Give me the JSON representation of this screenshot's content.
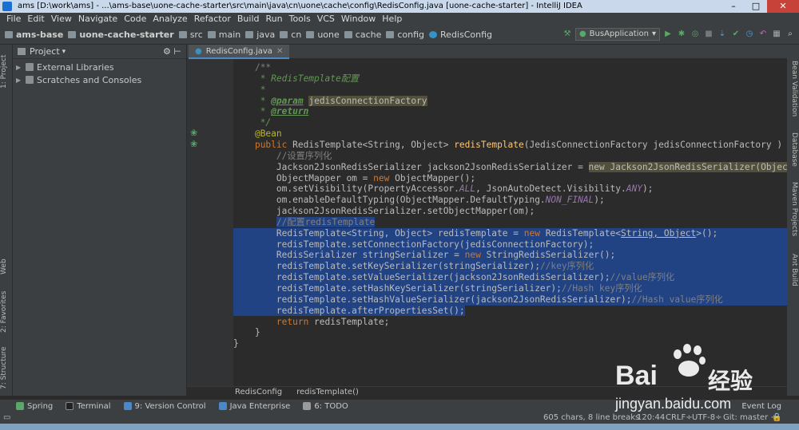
{
  "window": {
    "title": "ams [D:\\work\\ams] - ...\\ams-base\\uone-cache-starter\\src\\main\\java\\cn\\uone\\cache\\config\\RedisConfig.java [uone-cache-starter] - IntelliJ IDEA"
  },
  "menu": [
    "File",
    "Edit",
    "View",
    "Navigate",
    "Code",
    "Analyze",
    "Refactor",
    "Build",
    "Run",
    "Tools",
    "VCS",
    "Window",
    "Help"
  ],
  "breadcrumbs": [
    "ams-base",
    "uone-cache-starter",
    "src",
    "main",
    "java",
    "cn",
    "uone",
    "cache",
    "config",
    "RedisConfig"
  ],
  "run_config": "BusApplication",
  "project_panel": {
    "title": "Project",
    "items": [
      "External Libraries",
      "Scratches and Consoles"
    ]
  },
  "left_tabs": {
    "project": "1: Project",
    "web": "Web",
    "favorites": "2: Favorites",
    "structure": "7: Structure"
  },
  "right_tabs": [
    "Bean Validation",
    "Database",
    "Maven Projects",
    "Ant Build"
  ],
  "editor": {
    "tab": "RedisConfig.java"
  },
  "code_lines": [
    {
      "i": "    ",
      "segs": [
        [
          "cm",
          "/**"
        ]
      ]
    },
    {
      "i": "     ",
      "segs": [
        [
          "jd",
          "* RedisTemplate配置"
        ]
      ]
    },
    {
      "i": "     ",
      "segs": [
        [
          "jd",
          "*"
        ]
      ]
    },
    {
      "i": "     ",
      "segs": [
        [
          "jd",
          "* "
        ],
        [
          "jt",
          "@param"
        ],
        [
          "jd",
          " "
        ],
        [
          "hl",
          "jedisConnectionFactory"
        ]
      ]
    },
    {
      "i": "     ",
      "segs": [
        [
          "jd",
          "* "
        ],
        [
          "jt",
          "@return"
        ]
      ]
    },
    {
      "i": "     ",
      "segs": [
        [
          "jd",
          "*/"
        ]
      ]
    },
    {
      "i": "    ",
      "segs": [
        [
          "ann",
          "@Bean"
        ]
      ]
    },
    {
      "i": "    ",
      "segs": [
        [
          "kw",
          "public "
        ],
        [
          "",
          "RedisTemplate<String, Object> "
        ],
        [
          "fn",
          "redisTemplate"
        ],
        [
          "",
          "(JedisConnectionFactory jedisConnectionFactory ) {"
        ]
      ]
    },
    {
      "i": "        ",
      "segs": [
        [
          "cm",
          "//设置序列化"
        ]
      ]
    },
    {
      "i": "        ",
      "segs": [
        [
          "",
          "Jackson2JsonRedisSerializer jackson2JsonRedisSerializer = "
        ],
        [
          "hl",
          "new Jackson2JsonRedisSerializer(Object."
        ]
      ]
    },
    {
      "i": "        ",
      "segs": [
        [
          "",
          "ObjectMapper om = "
        ],
        [
          "kw",
          "new "
        ],
        [
          "",
          "ObjectMapper();"
        ]
      ]
    },
    {
      "i": "        ",
      "segs": [
        [
          "",
          "om.setVisibility(PropertyAccessor."
        ],
        [
          "st",
          "ALL"
        ],
        [
          "",
          ", JsonAutoDetect.Visibility."
        ],
        [
          "st",
          "ANY"
        ],
        [
          "",
          ");"
        ]
      ]
    },
    {
      "i": "        ",
      "segs": [
        [
          "",
          "om.enableDefaultTyping(ObjectMapper.DefaultTyping."
        ],
        [
          "st",
          "NON_FINAL"
        ],
        [
          "",
          ");"
        ]
      ]
    },
    {
      "i": "        ",
      "segs": [
        [
          "",
          "jackson2JsonRedisSerializer.setObjectMapper(om);"
        ]
      ]
    },
    {
      "i": "        ",
      "sel": true,
      "segs": [
        [
          "cm",
          "//配置redisTemplate"
        ]
      ]
    },
    {
      "i": "        ",
      "sel": true,
      "segs": [
        [
          "",
          "RedisTemplate<String, Object> redisTemplate = "
        ],
        [
          "kw",
          "new "
        ],
        [
          "",
          "RedisTemplate<"
        ],
        [
          "und",
          "String, Object"
        ],
        [
          "",
          ">();"
        ]
      ]
    },
    {
      "i": "        ",
      "sel": true,
      "segs": [
        [
          "",
          "redisTemplate.setConnectionFactory(jedisConnectionFactory);"
        ]
      ]
    },
    {
      "i": "        ",
      "sel": true,
      "segs": [
        [
          "",
          "RedisSerializer stringSerializer = "
        ],
        [
          "kw",
          "new "
        ],
        [
          "",
          "StringRedisSerializer();"
        ]
      ]
    },
    {
      "i": "        ",
      "sel": true,
      "segs": [
        [
          "",
          "redisTemplate.setKeySerializer(stringSerializer);"
        ],
        [
          "cm",
          "//key序列化"
        ]
      ]
    },
    {
      "i": "        ",
      "sel": true,
      "segs": [
        [
          "",
          "redisTemplate.setValueSerializer(jackson2JsonRedisSerializer);"
        ],
        [
          "cm",
          "//value序列化"
        ]
      ]
    },
    {
      "i": "        ",
      "sel": true,
      "segs": [
        [
          "",
          "redisTemplate.setHashKeySerializer(stringSerializer);"
        ],
        [
          "cm",
          "//Hash key序列化"
        ]
      ]
    },
    {
      "i": "        ",
      "sel": true,
      "segs": [
        [
          "",
          "redisTemplate.setHashValueSerializer(jackson2JsonRedisSerializer);"
        ],
        [
          "cm",
          "//Hash value序列化"
        ]
      ]
    },
    {
      "i": "        ",
      "sel": true,
      "segs": [
        [
          "",
          "redisTemplate.afterPropertiesSet();"
        ]
      ]
    },
    {
      "i": "        ",
      "segs": [
        [
          "kw",
          "return "
        ],
        [
          "",
          "redisTemplate;"
        ]
      ]
    },
    {
      "i": "    ",
      "segs": [
        [
          "",
          "}"
        ]
      ]
    },
    {
      "i": "",
      "segs": [
        [
          "",
          "}"
        ]
      ]
    }
  ],
  "editor_breadcrumb": [
    "RedisConfig",
    "redisTemplate()"
  ],
  "bottom_tools": [
    "Spring",
    "Terminal",
    "9: Version Control",
    "Java Enterprise",
    "6: TODO"
  ],
  "event_log": "Event Log",
  "status": {
    "chars": "605 chars, 8 line breaks",
    "pos": "120:44",
    "crlf": "CRLF÷",
    "encoding": "UTF-8÷",
    "git": "Git: master ÷"
  },
  "watermark": {
    "brand": "Bai",
    "brand2": "经验",
    "url": "jingyan.baidu.com"
  }
}
